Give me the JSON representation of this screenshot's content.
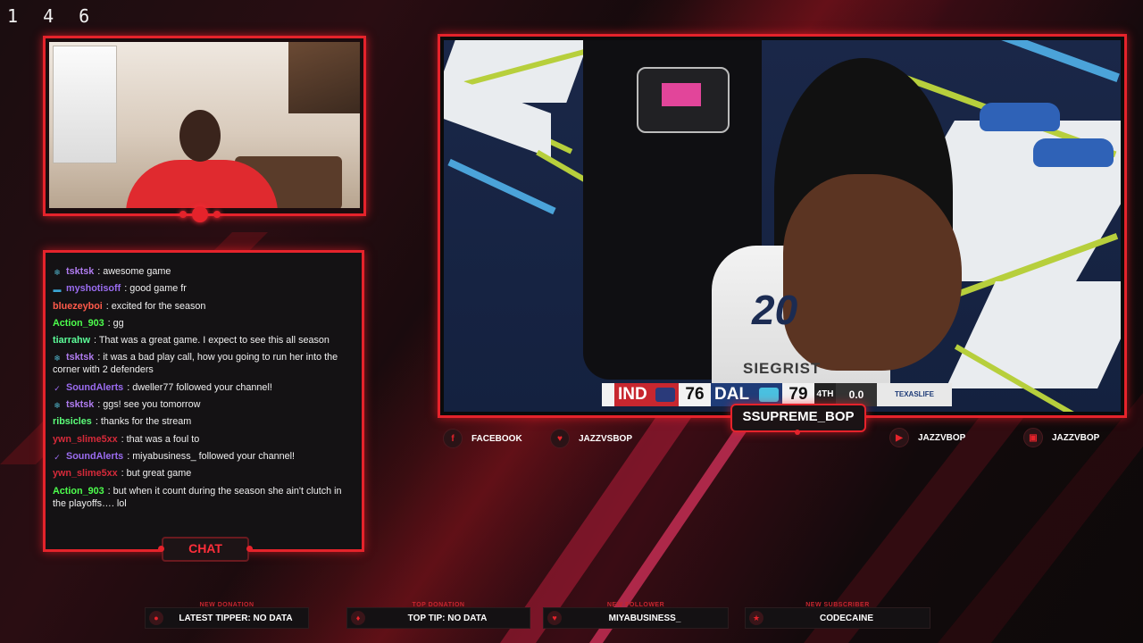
{
  "counter": "1 4 6",
  "chat": {
    "tab_label": "CHAT",
    "messages": [
      {
        "badge": "❄",
        "badge_color": "#4fb3c9",
        "user": "tsktsk",
        "user_color": "#b07cf0",
        "text": "awesome game"
      },
      {
        "badge": "▬",
        "badge_color": "#3aa5d4",
        "user": "myshotisoff",
        "user_color": "#9a6cf0",
        "text": "good game fr"
      },
      {
        "badge": "",
        "badge_color": "",
        "user": "bluezeyboi",
        "user_color": "#ff5a4a",
        "text": "excited for the season"
      },
      {
        "badge": "",
        "badge_color": "",
        "user": "Action_903",
        "user_color": "#4dff4d",
        "text": "gg"
      },
      {
        "badge": "",
        "badge_color": "",
        "user": "tiarrahw",
        "user_color": "#5cff9a",
        "text": "That was a great game. I expect to see this all season"
      },
      {
        "badge": "❄",
        "badge_color": "#4fb3c9",
        "user": "tsktsk",
        "user_color": "#b07cf0",
        "text": "it was a bad play call, how you going to run her into the corner with 2 defenders"
      },
      {
        "badge": "✓",
        "badge_color": "#9b6cf0",
        "user": "SoundAlerts",
        "user_color": "#9b6cf0",
        "text": "dweller77 followed your channel!"
      },
      {
        "badge": "❄",
        "badge_color": "#4fb3c9",
        "user": "tsktsk",
        "user_color": "#b07cf0",
        "text": "ggs! see you tomorrow"
      },
      {
        "badge": "",
        "badge_color": "",
        "user": "ribsicles",
        "user_color": "#5cff7a",
        "text": "thanks for the stream"
      },
      {
        "badge": "",
        "badge_color": "",
        "user": "ywn_slime5xx",
        "user_color": "#d62a3a",
        "text": "that was a foul to"
      },
      {
        "badge": "✓",
        "badge_color": "#9b6cf0",
        "user": "SoundAlerts",
        "user_color": "#9b6cf0",
        "text": "miyabusiness_ followed your channel!"
      },
      {
        "badge": "",
        "badge_color": "",
        "user": "ywn_slime5xx",
        "user_color": "#d62a3a",
        "text": "but great game"
      },
      {
        "badge": "",
        "badge_color": "",
        "user": "Action_903",
        "user_color": "#4dff4d",
        "text": "but when it count during the season she ain't clutch in the playoffs…. lol"
      }
    ]
  },
  "game": {
    "jersey_number": "20",
    "jersey_name": "SIEGRIST",
    "scoreboard": {
      "home_team": "IND",
      "home_score": "76",
      "away_team": "DAL",
      "away_score": "79",
      "period": "4TH",
      "clock": "0.0",
      "sponsor": "TEXASLIFE"
    }
  },
  "streamer_name": "SSUPREME_BOP",
  "socials": [
    {
      "icon": "facebook-icon",
      "label": "FACEBOOK"
    },
    {
      "icon": "heart-icon",
      "label": "JAZZVSBOP"
    },
    {
      "icon": "youtube-icon",
      "label": "JAZZVBOP"
    },
    {
      "icon": "twitch-icon",
      "label": "JAZZVBOP"
    }
  ],
  "stats": [
    {
      "label": "NEW DONATION",
      "value": "LATEST TIPPER: NO DATA",
      "icon": "donation-icon"
    },
    {
      "label": "TOP DONATION",
      "value": "TOP TIP: NO DATA",
      "icon": "drop-icon"
    },
    {
      "label": "NEW FOLLOWER",
      "value": "MIYABUSINESS_",
      "icon": "heart-icon"
    },
    {
      "label": "NEW SUBSCRIBER",
      "value": "CODECAINE",
      "icon": "star-icon"
    }
  ],
  "colors": {
    "accent": "#e5232b",
    "background": "#0d0a0b"
  }
}
